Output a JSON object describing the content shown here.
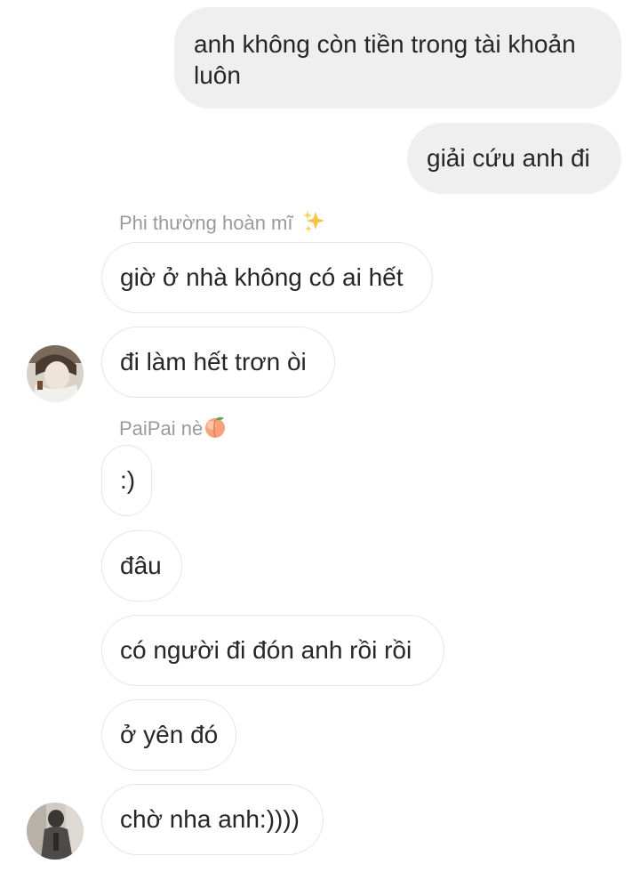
{
  "thread": {
    "outgoing": [
      {
        "text_line1": "anh không còn tiền trong tài khoản",
        "text_line2": "luôn"
      },
      {
        "text": "giải cứu anh đi"
      }
    ],
    "group1": {
      "sender": "Phi thường hoàn mĩ",
      "sender_emoji": "sparkles-icon",
      "messages": [
        {
          "text": "giờ ở nhà không có ai hết"
        },
        {
          "text": "đi làm hết trơn òi"
        }
      ]
    },
    "group2": {
      "sender": "PaiPai nè",
      "sender_emoji": "peach-icon",
      "messages": [
        {
          "text": ":)"
        },
        {
          "text": "đâu"
        },
        {
          "text": "có người đi đón anh rồi rồi"
        },
        {
          "text": "ở yên đó"
        },
        {
          "text": "chờ nha anh:))))"
        }
      ]
    }
  },
  "colors": {
    "outgoing_bubble": "#efefef",
    "incoming_border": "#e6e6e6",
    "sender_name": "#9a9a9a",
    "text": "#262626"
  }
}
